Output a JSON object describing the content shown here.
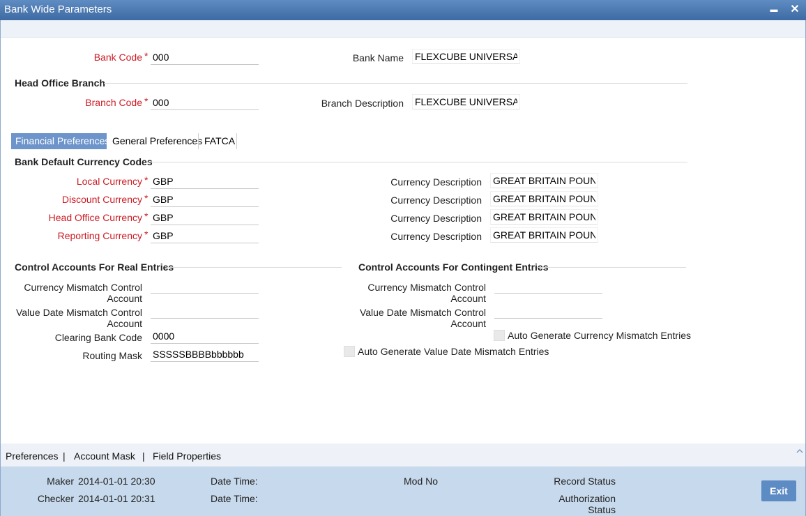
{
  "window": {
    "title": "Bank Wide Parameters",
    "minimize_glyph": "▬",
    "close_glyph": "✕"
  },
  "bank": {
    "code_label": "Bank Code",
    "code_value": "000",
    "name_label": "Bank Name",
    "name_value": "FLEXCUBE UNIVERSAL I"
  },
  "head_office": {
    "title": "Head Office Branch",
    "branch_code_label": "Branch Code",
    "branch_code_value": "000",
    "branch_desc_label": "Branch Description",
    "branch_desc_value": "FLEXCUBE UNIVERSAL I"
  },
  "tabs": [
    {
      "label": "Financial Preferences",
      "active": true
    },
    {
      "label": "General Preferences",
      "active": false
    },
    {
      "label": "FATCA",
      "active": false
    }
  ],
  "currency": {
    "title": "Bank Default Currency Codes",
    "rows": [
      {
        "label": "Local Currency",
        "value": "GBP",
        "desc_label": "Currency Description",
        "desc_value": "GREAT BRITAIN POUND"
      },
      {
        "label": "Discount Currency",
        "value": "GBP",
        "desc_label": "Currency Description",
        "desc_value": "GREAT BRITAIN POUND"
      },
      {
        "label": "Head Office Currency",
        "value": "GBP",
        "desc_label": "Currency Description",
        "desc_value": "GREAT BRITAIN POUND"
      },
      {
        "label": "Reporting Currency",
        "value": "GBP",
        "desc_label": "Currency Description",
        "desc_value": "GREAT BRITAIN POUND"
      }
    ]
  },
  "real_entries": {
    "title": "Control Accounts For Real Entries",
    "currency_mismatch_l1": "Currency Mismatch Control",
    "currency_mismatch_l2": "Account",
    "currency_mismatch_value": "",
    "value_date_l1": "Value Date Mismatch Control",
    "value_date_l2": "Account",
    "value_date_value": "",
    "clearing_label": "Clearing Bank Code",
    "clearing_value": "0000",
    "routing_label": "Routing Mask",
    "routing_value": "SSSSSBBBBbbbbbb"
  },
  "contingent_entries": {
    "title": "Control Accounts For Contingent Entries",
    "currency_mismatch_l1": "Currency Mismatch Control",
    "currency_mismatch_l2": "Account",
    "currency_mismatch_value": "",
    "value_date_l1": "Value Date Mismatch Control",
    "value_date_l2": "Account",
    "value_date_value": "",
    "auto_currency_label": "Auto Generate Currency Mismatch Entries",
    "auto_value_date_label": "Auto Generate Value Date Mismatch Entries"
  },
  "bottom_links": [
    "Preferences",
    "Account Mask",
    "Field Properties"
  ],
  "link_separator": "|",
  "footer": {
    "maker_label": "Maker",
    "maker_value": "2014-01-01 20:30",
    "checker_label": "Checker",
    "checker_value": "2014-01-01 20:31",
    "datetime_label": "Date Time:",
    "mod_no_label": "Mod No",
    "record_status_label": "Record Status",
    "auth_status_l1": "Authorization",
    "auth_status_l2": "Status",
    "exit_label": "Exit"
  },
  "colors": {
    "title_bar": "#4a78b4",
    "accent": "#6d95cb",
    "required": "#cc1b24",
    "footer": "#c7d9ec"
  },
  "icons": {
    "collapse": "chevron-up-icon"
  }
}
